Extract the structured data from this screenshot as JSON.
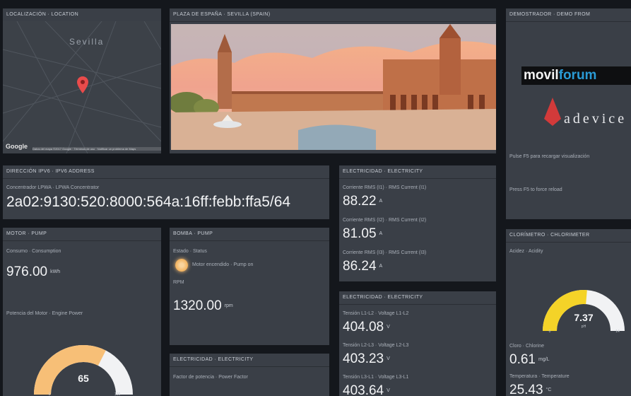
{
  "location": {
    "title": "LOCALIZACIÓN · LOCATION",
    "city": "Sevilla",
    "brand": "Google",
    "footer": "Datos del mapa ©2017 Google · Términos de uso · Notificar un problema de Maps"
  },
  "photo": {
    "title": "PLAZA DE ESPAÑA · SEVILLA (SPAIN)"
  },
  "demo": {
    "title": "DEMOSTRADOR · DEMO FROM",
    "brand_a": "movil",
    "brand_b": "forum",
    "adevice": "adevice",
    "f5_text": "Pulse F5 para recargar visualización",
    "f5_en": "Press F5 to force reload"
  },
  "ipv6": {
    "title": "DIRECCIÓN IPV6 · IPV6 ADDRESS",
    "label": "Concentrador LPWA · LPWA Concentrator",
    "address": "2a02:9130:520:8000:564a:16ff:febb:ffa5/64"
  },
  "elec1": {
    "title": "ELECTRICIDAD · ELECTRICITY",
    "rows": [
      {
        "label": "Corriente RMS (I1) · RMS Current (I1)",
        "value": "88.22",
        "unit": "A"
      },
      {
        "label": "Corriente RMS (I2) · RMS Current (I2)",
        "value": "81.05",
        "unit": "A"
      },
      {
        "label": "Corriente RMS (I3) · RMS Current (I3)",
        "value": "86.24",
        "unit": "A"
      }
    ]
  },
  "motor": {
    "title": "MOTOR · PUMP",
    "consumption_label": "Consumo · Consumption",
    "consumption": "976.00",
    "consumption_unit": "kWh",
    "power_label": "Potencia del Motor · Engine Power",
    "gauge_value": "65",
    "gauge_min": "0",
    "gauge_max": "100",
    "gauge_fraction": 0.65
  },
  "bomba": {
    "title": "BOMBA · PUMP",
    "state_label": "Estado · Status",
    "state_text": "Motor encendido · Pump on",
    "rpm_label": "RPM",
    "rpm": "1320.00",
    "rpm_unit": "rpm"
  },
  "elec3": {
    "title": "ELECTRICIDAD · ELECTRICITY",
    "label": "Factor de potencia · Power Factor"
  },
  "elec2": {
    "title": "ELECTRICIDAD · ELECTRICITY",
    "rows": [
      {
        "label": "Tensión L1-L2 · Voltage L1-L2",
        "value": "404.08",
        "unit": "V"
      },
      {
        "label": "Tensión L2-L3 · Voltage L2-L3",
        "value": "403.23",
        "unit": "V"
      },
      {
        "label": "Tensión L3-L1 · Voltage L3-L1",
        "value": "403.64",
        "unit": "V"
      }
    ]
  },
  "clor": {
    "title": "CLORÍMETRO · CHLORIMETER",
    "activity_label": "Acidez · Acidity",
    "gauge_value": "7.37",
    "gauge_unit": "pH",
    "gauge_min": "0",
    "gauge_max": "14",
    "gauge_fraction": 0.5264,
    "chlorine_label": "Cloro · Chlorine",
    "chlorine": "0.61",
    "chlorine_unit": "mg/L",
    "temp_label": "Temperatura · Temperature",
    "temp": "25.43",
    "temp_unit": "°C"
  },
  "colors": {
    "accent_orange": "#f7bf77",
    "accent_yellow": "#f4d328",
    "pin": "#e94b4b",
    "panel": "#3a3f47",
    "background": "#14171c"
  }
}
